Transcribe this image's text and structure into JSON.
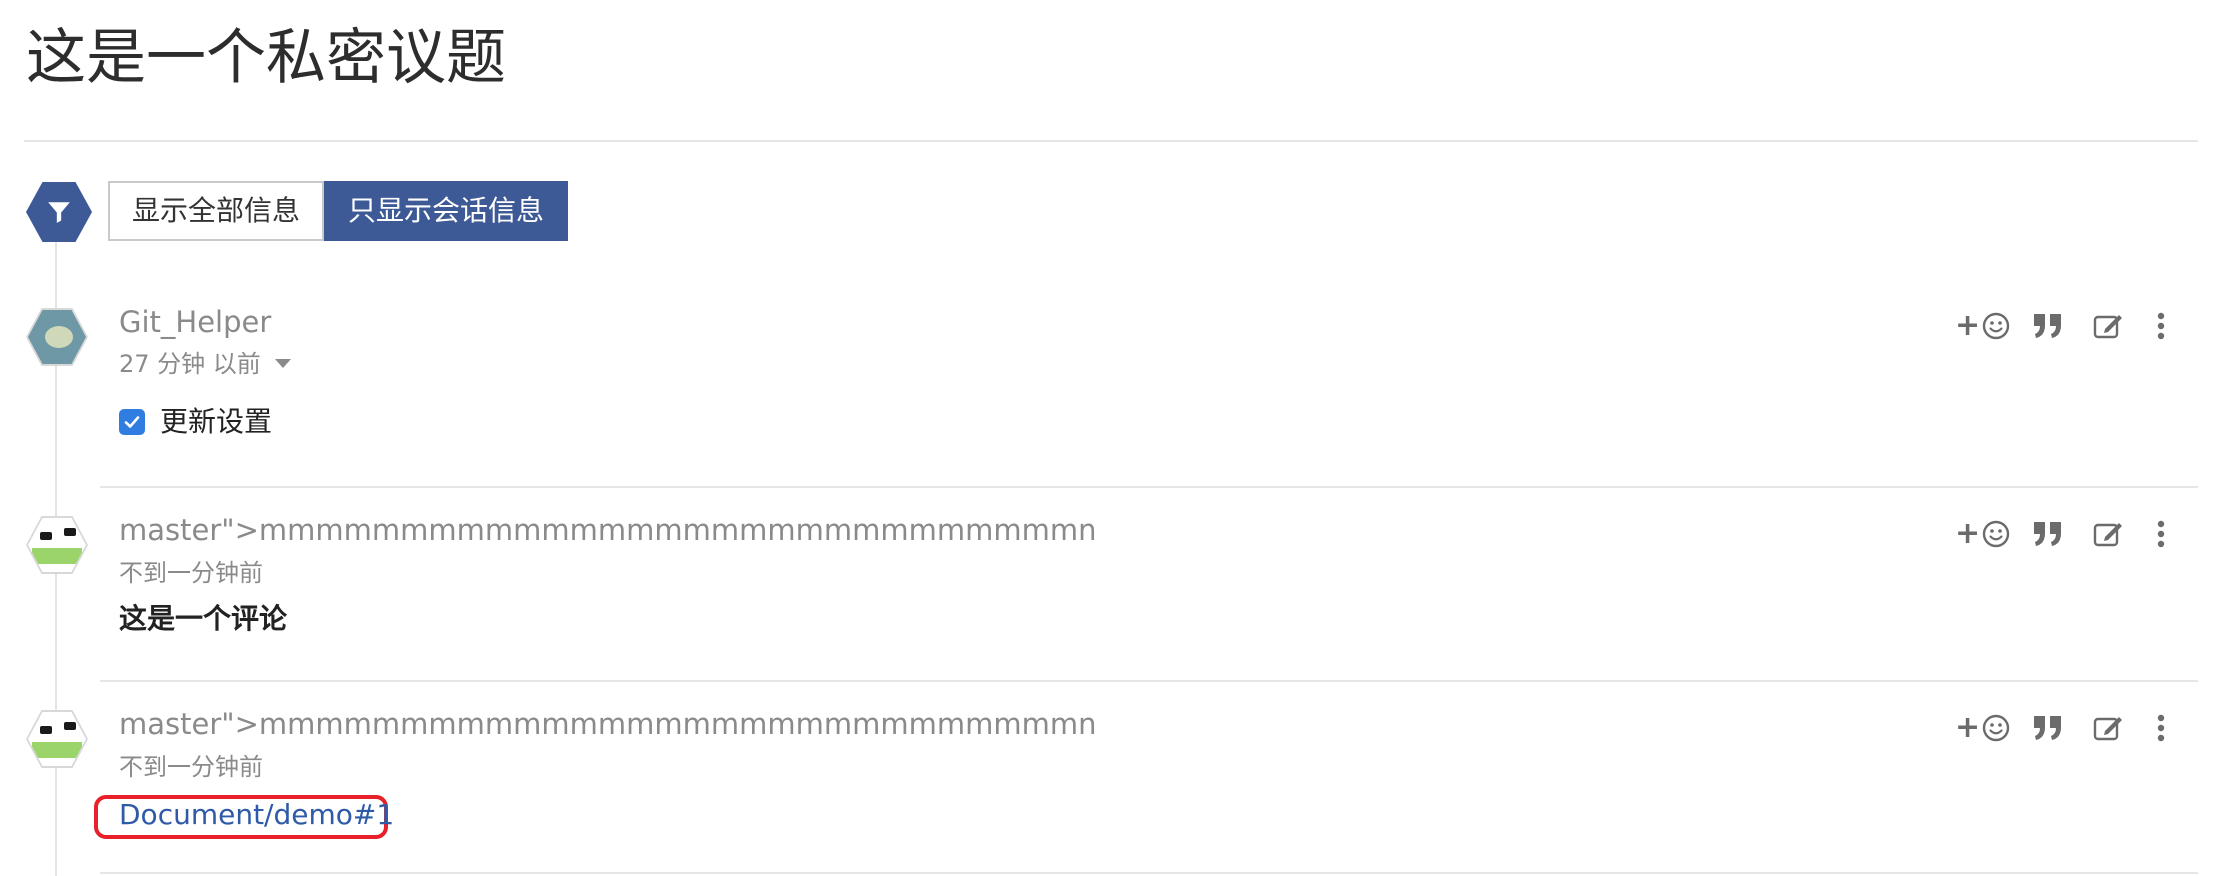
{
  "page": {
    "title": "这是一个私密议题"
  },
  "filter": {
    "icon": "filter-icon",
    "buttons": [
      {
        "label": "显示全部信息",
        "active": false
      },
      {
        "label": "只显示会话信息",
        "active": true
      }
    ],
    "accent_color": "#3d5a96"
  },
  "comments": [
    {
      "author": "Git_Helper",
      "time": "27 分钟 以前",
      "has_time_dropdown": true,
      "body": {
        "type": "checkbox",
        "checked": true,
        "label": "更新设置"
      }
    },
    {
      "author": "master\">mmmmmmmmmmmmmmmmmmmmmmmmmmmmmn",
      "time": "不到一分钟前",
      "body": {
        "type": "text",
        "text": "这是一个评论"
      }
    },
    {
      "author": "master\">mmmmmmmmmmmmmmmmmmmmmmmmmmmmmn",
      "time": "不到一分钟前",
      "body": {
        "type": "link",
        "text": "Document/demo#1",
        "highlight_color": "#e8202a"
      }
    }
  ],
  "actions": {
    "reaction_plus": "+",
    "icons": [
      "add-reaction-icon",
      "quote-icon",
      "edit-icon",
      "more-options-icon"
    ]
  }
}
